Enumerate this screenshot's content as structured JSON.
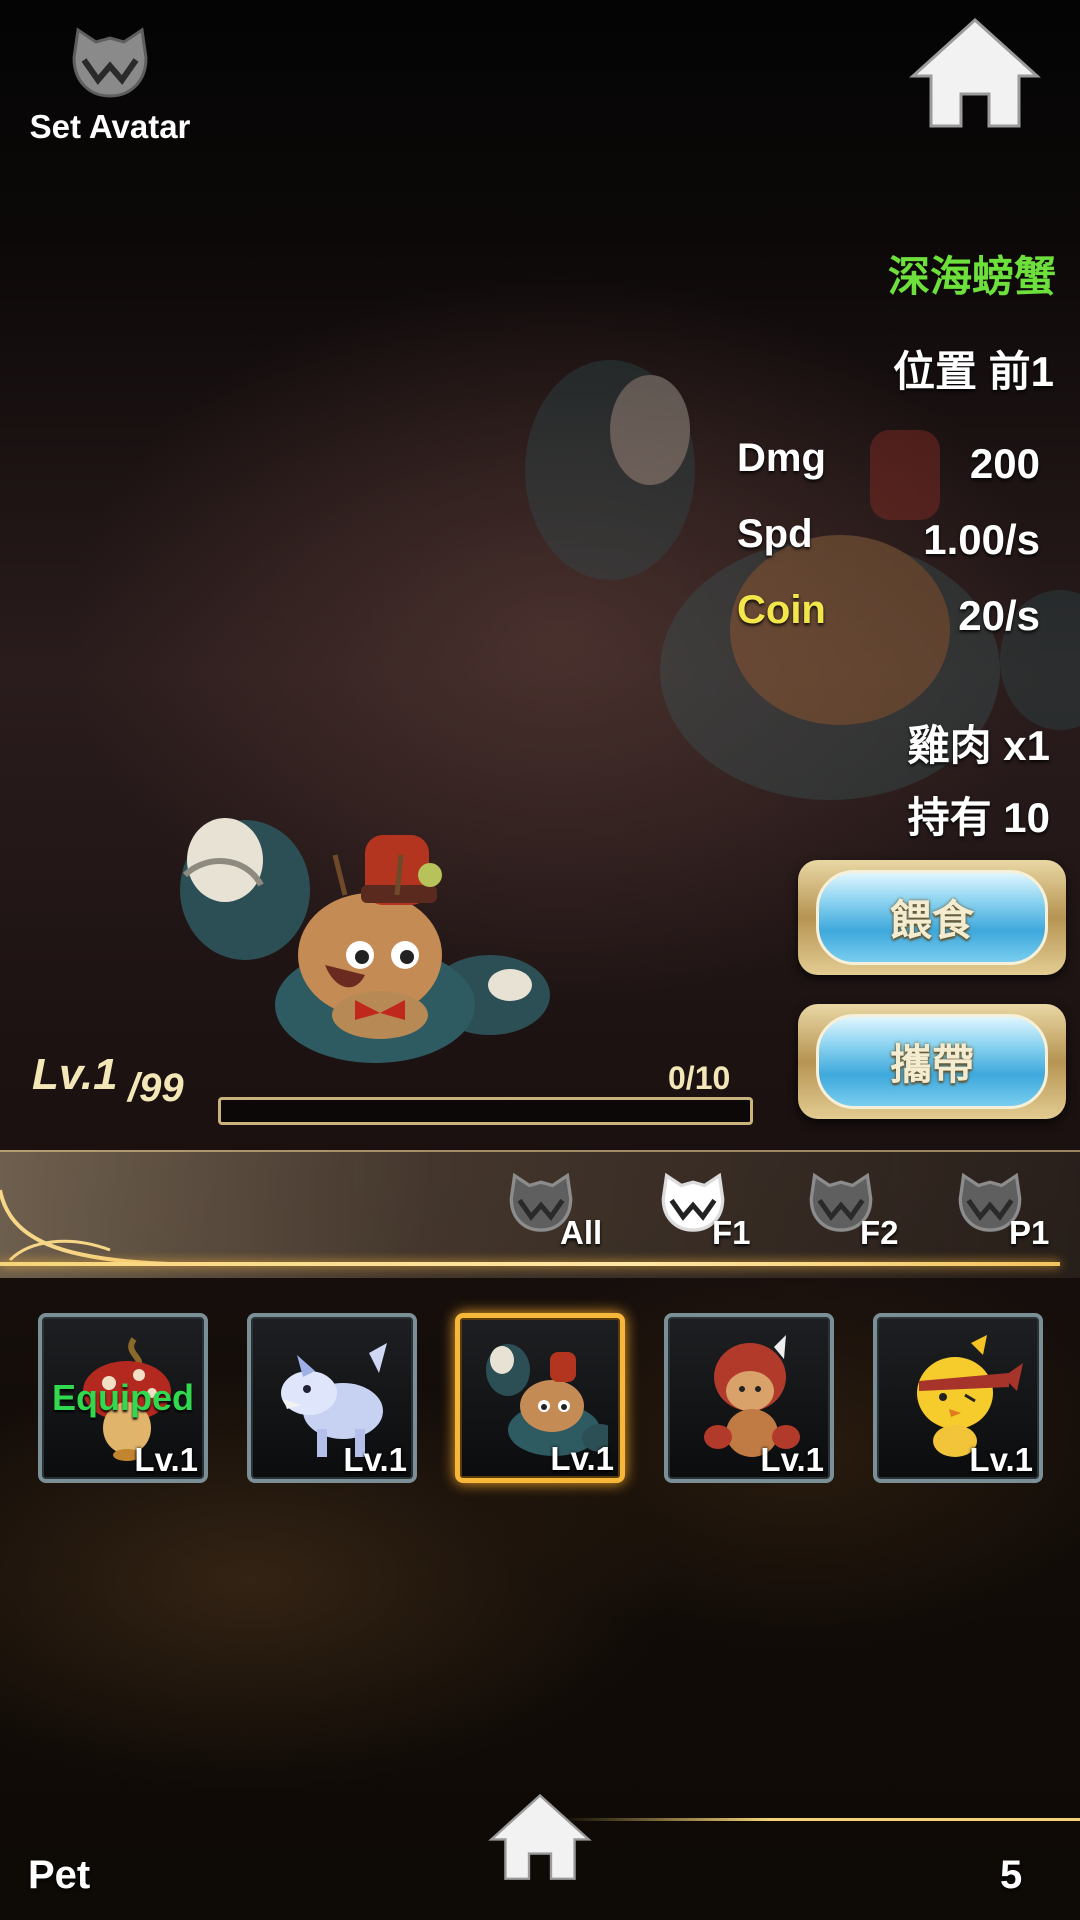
{
  "header": {
    "set_avatar_label": "Set Avatar",
    "avatar_icon": "wolf-emblem-icon",
    "home_icon": "home-icon"
  },
  "pet_detail": {
    "name": "深海螃蟹",
    "position": "位置 前1",
    "stats": [
      {
        "label": "Dmg",
        "value": "200"
      },
      {
        "label": "Spd",
        "value": "1.00/s"
      },
      {
        "label": "Coin",
        "value": "20/s"
      }
    ],
    "food": "雞肉 x1",
    "held": "持有 10",
    "feed_button": "餵食",
    "carry_button": "攜帶",
    "level_current": "Lv.1",
    "level_max": "/99",
    "exp_text": "0/10",
    "exp_fraction": 0
  },
  "filter_tabs": [
    {
      "label": "All"
    },
    {
      "label": "F1",
      "selected": true
    },
    {
      "label": "F2"
    },
    {
      "label": "P1"
    }
  ],
  "pets": [
    {
      "level": "Lv.1",
      "badge": "Equiped",
      "icon": "mushroom-pet-icon"
    },
    {
      "level": "Lv.1",
      "icon": "ice-wolf-pet-icon"
    },
    {
      "level": "Lv.1",
      "icon": "deep-sea-crab-pet-icon",
      "selected": true
    },
    {
      "level": "Lv.1",
      "icon": "dragon-hood-pet-icon"
    },
    {
      "level": "Lv.1",
      "icon": "chick-pet-icon"
    }
  ],
  "footer": {
    "title": "Pet",
    "count": "5",
    "home_icon": "home-icon"
  },
  "colors": {
    "name_green": "#6ee03c",
    "coin_yellow": "#f2e64a",
    "equipped_green": "#31d94f",
    "selected_gold": "#f7b73a"
  }
}
